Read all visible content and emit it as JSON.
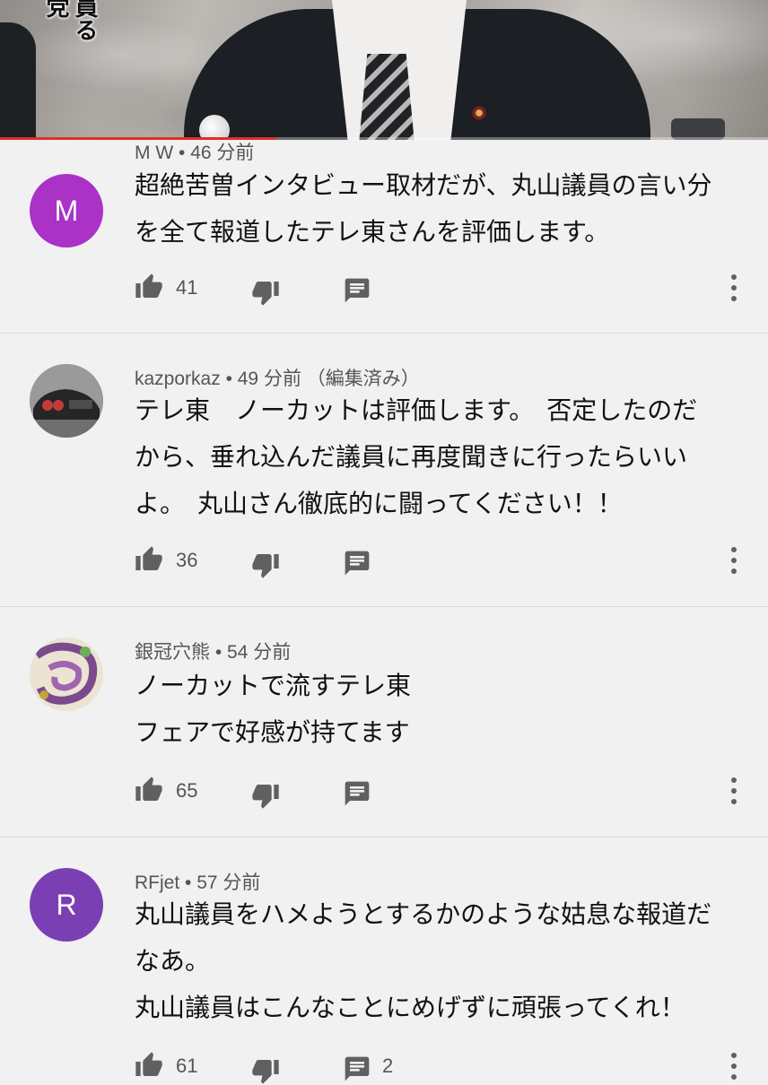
{
  "video": {
    "caption": "員る党",
    "progress_fraction": 0.36
  },
  "colors": {
    "progress_red": "#e52d27",
    "avatar_m": "#aa32c7",
    "avatar_r": "#7b3fb4"
  },
  "icons": {
    "like": "thumb-up-icon",
    "dislike": "thumb-down-icon",
    "reply": "comment-icon",
    "more": "more-vert-icon"
  },
  "comments": [
    {
      "avatar_letter": "M",
      "author": "M W",
      "time": "46 分前",
      "edited": "",
      "lines": [
        "超絶苦曽インタビュー取材だが、丸山議員の言い分",
        "を全て報道したテレ東さんを評価します。"
      ],
      "likes": "41",
      "replies": ""
    },
    {
      "avatar_letter": "",
      "author": "kazporkaz",
      "time": "49 分前",
      "edited": "（編集済み）",
      "lines": [
        "テレ東　ノーカットは評価します。　否定したのだ",
        "から、垂れ込んだ議員に再度聞きに行ったらいい",
        "よ。　丸山さん徹底的に闘ってください！！"
      ],
      "likes": "36",
      "replies": ""
    },
    {
      "avatar_letter": "",
      "author": "銀冠穴熊",
      "time": "54 分前",
      "edited": "",
      "lines": [
        "ノーカットで流すテレ東",
        "フェアで好感が持てます"
      ],
      "likes": "65",
      "replies": ""
    },
    {
      "avatar_letter": "R",
      "author": "RFjet",
      "time": "57 分前",
      "edited": "",
      "lines": [
        "丸山議員をハメようとするかのような姑息な報道だ",
        "なあ。",
        "丸山議員はこんなことにめげずに頑張ってくれ！"
      ],
      "likes": "61",
      "replies": "2"
    }
  ]
}
